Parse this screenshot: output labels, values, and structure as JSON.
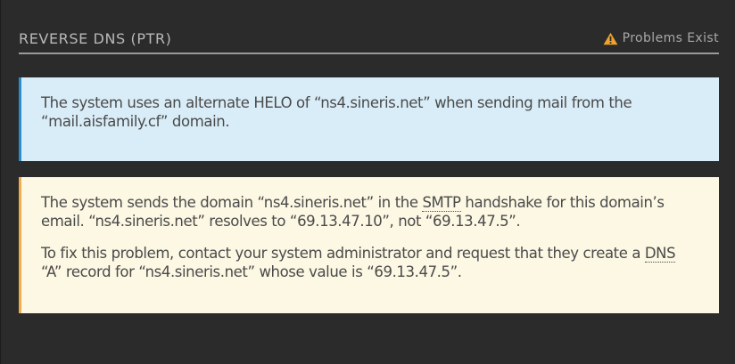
{
  "header": {
    "title": "REVERSE DNS (PTR)",
    "status_label": "Problems Exist",
    "status_icon": "warning-triangle-icon",
    "status_color": "#f0a22b"
  },
  "info_alert": {
    "text": "The system uses an alternate HELO of “ns4.sineris.net” when sending mail from the “mail.aisfamily.cf” domain."
  },
  "warning_alert": {
    "p1_before": "The system sends the domain “ns4.sineris.net” in the ",
    "p1_abbr": "SMTP",
    "p1_after": " handshake for this domain’s email. “ns4.sineris.net” resolves to “69.13.47.10”, not “69.13.47.5”.",
    "p2_before": "To fix this problem, contact your system administrator and request that they create a ",
    "p2_abbr": "DNS",
    "p2_after": " “A” record for “ns4.sineris.net” whose value is “69.13.47.5”."
  },
  "colors": {
    "info_bg": "#d9edf8",
    "info_border": "#2b8ec9",
    "warning_bg": "#fcf8e3",
    "warning_border": "#f0ad4e"
  }
}
